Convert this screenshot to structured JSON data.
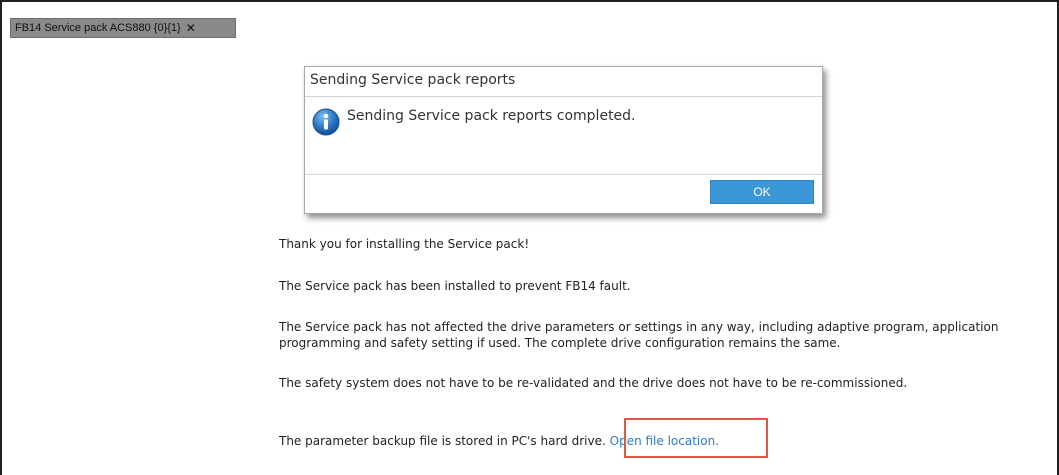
{
  "tab": {
    "title": "FB14 Service pack ACS880 {0}{1}",
    "close_label": "✕"
  },
  "dialog": {
    "title": "Sending Service pack reports",
    "message": "Sending Service pack reports completed.",
    "icon": "info-icon",
    "ok_label": "OK"
  },
  "content": {
    "line1": "Thank you for installing the Service pack!",
    "line2": "The Service pack has been installed to prevent FB14 fault.",
    "line3a": "The Service pack has not affected the drive parameters or settings in any way, including adaptive program, application",
    "line3b": "programming and safety setting if used. The complete drive configuration remains the same.",
    "line4": "The safety system does not have to be re-validated and the drive does not have to be re-commissioned.",
    "line5_text": "The parameter backup file is stored in PC's hard drive.",
    "line5_link": "Open file location."
  },
  "colors": {
    "link": "#2c7bcb",
    "ok_button": "#3b97d6",
    "highlight": "#e2573f",
    "tab": "#8a8a8a"
  }
}
